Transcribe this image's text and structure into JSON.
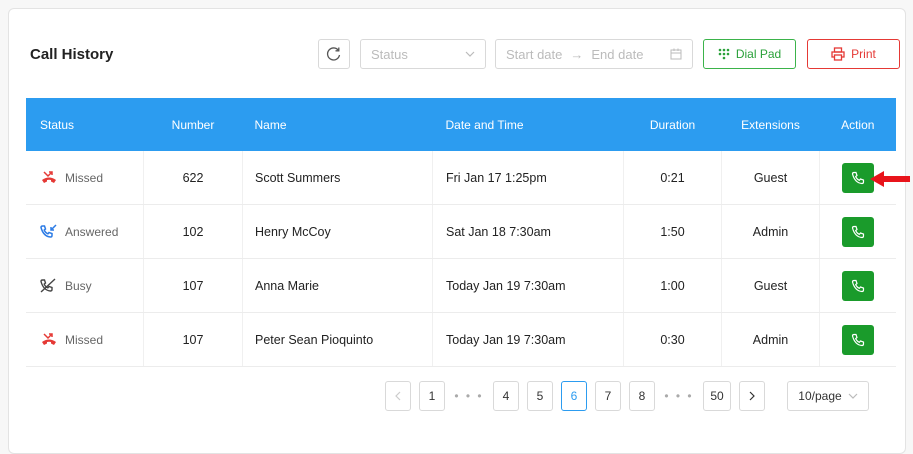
{
  "header": {
    "title": "Call History",
    "status_placeholder": "Status",
    "start_date_placeholder": "Start date",
    "end_date_placeholder": "End date",
    "dialpad_label": "Dial Pad",
    "print_label": "Print"
  },
  "table": {
    "columns": [
      "Status",
      "Number",
      "Name",
      "Date and Time",
      "Duration",
      "Extensions",
      "Action"
    ],
    "rows": [
      {
        "status": "Missed",
        "status_icon": "missed-call-icon",
        "number": "622",
        "name": "Scott Summers",
        "datetime": "Fri Jan 17 1:25pm",
        "duration": "0:21",
        "extension": "Guest"
      },
      {
        "status": "Answered",
        "status_icon": "incoming-call-icon",
        "number": "102",
        "name": "Henry McCoy",
        "datetime": "Sat Jan 18 7:30am",
        "duration": "1:50",
        "extension": "Admin"
      },
      {
        "status": "Busy",
        "status_icon": "busy-call-icon",
        "number": "107",
        "name": "Anna Marie",
        "datetime": "Today Jan 19 7:30am",
        "duration": "1:00",
        "extension": "Guest"
      },
      {
        "status": "Missed",
        "status_icon": "missed-call-icon",
        "number": "107",
        "name": "Peter Sean Pioquinto",
        "datetime": "Today Jan 19 7:30am",
        "duration": "0:30",
        "extension": "Admin"
      }
    ]
  },
  "pagination": {
    "pages": [
      "1",
      "4",
      "5",
      "6",
      "7",
      "8",
      "50"
    ],
    "current": "6",
    "ellipsis": "• • •",
    "per_page": "10/page"
  },
  "colors": {
    "header_blue": "#2c9cf0",
    "call_green": "#1a9b2b",
    "missed_red": "#e53935",
    "answered_blue": "#2c7be5"
  }
}
